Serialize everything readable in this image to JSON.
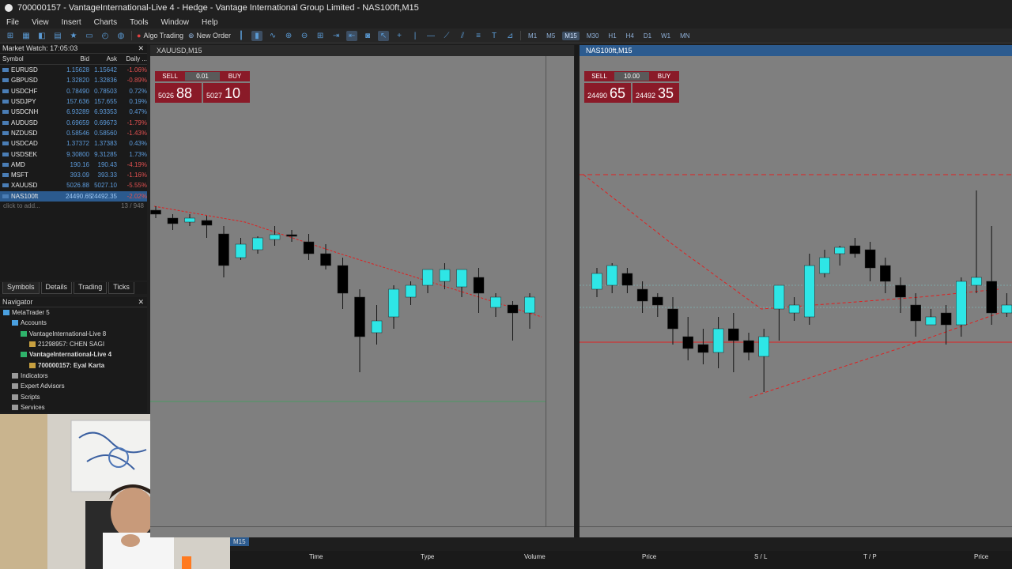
{
  "window": {
    "title": "700000157 - VantageInternational-Live 4 - Hedge - Vantage International Group Limited - NAS100ft,M15"
  },
  "menu": [
    "File",
    "View",
    "Insert",
    "Charts",
    "Tools",
    "Window",
    "Help"
  ],
  "toolbar": {
    "algo_trading": "Algo Trading",
    "new_order": "New Order",
    "timeframes": [
      "M1",
      "M5",
      "M15",
      "M30",
      "H1",
      "H4",
      "D1",
      "W1",
      "MN"
    ],
    "active_timeframe": "M15"
  },
  "market_watch": {
    "title": "Market Watch: 17:05:03",
    "columns": [
      "Symbol",
      "Bid",
      "Ask",
      "Daily ..."
    ],
    "rows": [
      {
        "symbol": "EURUSD",
        "bid": "1.15628",
        "ask": "1.15642",
        "change": "-1.06%",
        "neg": true
      },
      {
        "symbol": "GBPUSD",
        "bid": "1.32820",
        "ask": "1.32836",
        "change": "-0.89%",
        "neg": true
      },
      {
        "symbol": "USDCHF",
        "bid": "0.78490",
        "ask": "0.78503",
        "change": "0.72%",
        "neg": false
      },
      {
        "symbol": "USDJPY",
        "bid": "157.636",
        "ask": "157.655",
        "change": "0.19%",
        "neg": false
      },
      {
        "symbol": "USDCNH",
        "bid": "6.93289",
        "ask": "6.93353",
        "change": "0.47%",
        "neg": false
      },
      {
        "symbol": "AUDUSD",
        "bid": "0.69659",
        "ask": "0.69673",
        "change": "-1.79%",
        "neg": true
      },
      {
        "symbol": "NZDUSD",
        "bid": "0.58546",
        "ask": "0.58560",
        "change": "-1.43%",
        "neg": true
      },
      {
        "symbol": "USDCAD",
        "bid": "1.37372",
        "ask": "1.37383",
        "change": "0.43%",
        "neg": false
      },
      {
        "symbol": "USDSEK",
        "bid": "9.30800",
        "ask": "9.31285",
        "change": "1.73%",
        "neg": false
      },
      {
        "symbol": "AMD",
        "bid": "190.16",
        "ask": "190.43",
        "change": "-4.19%",
        "neg": true
      },
      {
        "symbol": "MSFT",
        "bid": "393.09",
        "ask": "393.33",
        "change": "-1.16%",
        "neg": true
      },
      {
        "symbol": "XAUUSD",
        "bid": "5026.88",
        "ask": "5027.10",
        "change": "-5.55%",
        "neg": true
      },
      {
        "symbol": "NAS100ft",
        "bid": "24490.65",
        "ask": "24492.35",
        "change": "-2.02%",
        "neg": true
      }
    ],
    "add_label": "click to add...",
    "count": "13 / 948",
    "tabs": [
      "Symbols",
      "Details",
      "Trading",
      "Ticks"
    ]
  },
  "navigator": {
    "title": "Navigator",
    "items": [
      {
        "label": "MetaTrader 5",
        "indent": 0,
        "bold": false
      },
      {
        "label": "Accounts",
        "indent": 1,
        "bold": false
      },
      {
        "label": "VantageInternational-Live 8",
        "indent": 2,
        "bold": false
      },
      {
        "label": "21298957: CHEN SAGI",
        "indent": 3,
        "bold": false
      },
      {
        "label": "VantageInternational-Live 4",
        "indent": 2,
        "bold": true
      },
      {
        "label": "700000157: Eyal Karta",
        "indent": 3,
        "bold": true
      },
      {
        "label": "Indicators",
        "indent": 1,
        "bold": false
      },
      {
        "label": "Expert Advisors",
        "indent": 1,
        "bold": false
      },
      {
        "label": "Scripts",
        "indent": 1,
        "bold": false
      },
      {
        "label": "Services",
        "indent": 1,
        "bold": false
      }
    ]
  },
  "chart_left": {
    "tab": "XAUUSD,M15",
    "sell": "SELL",
    "buy": "BUY",
    "lot": "0.01",
    "bid_prefix": "5026",
    "bid_big": "88",
    "ask_prefix": "5027",
    "ask_big": "10"
  },
  "chart_right": {
    "tab": "NAS100ft,M15",
    "sell": "SELL",
    "buy": "BUY",
    "lot": "10.00",
    "bid_prefix": "24490",
    "bid_big": "65",
    "ask_prefix": "24492",
    "ask_big": "35"
  },
  "bottom_tab": "M15",
  "terminal": {
    "columns": [
      "Time",
      "Type",
      "Volume",
      "Price",
      "S / L",
      "T / P",
      "Price"
    ]
  },
  "colors": {
    "bull": "#2ee6e6",
    "bear": "#000000",
    "chart_bg": "#7f7f7f",
    "trendline": "#e02020",
    "selected": "#2b5a8e"
  }
}
